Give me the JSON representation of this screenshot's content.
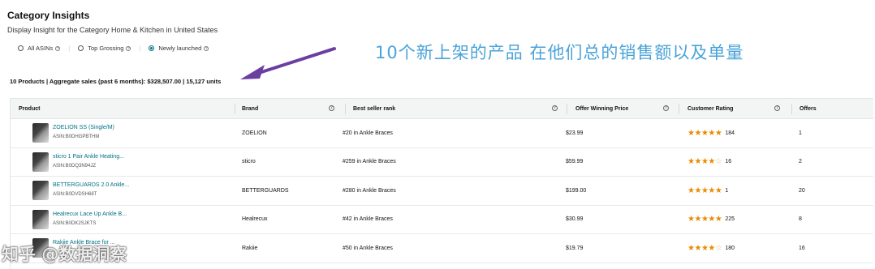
{
  "header": {
    "title": "Category Insights",
    "subtitle": "Display Insight for the Category Home & Kitchen in United States"
  },
  "filters": {
    "options": [
      {
        "label": "All ASINs",
        "checked": false
      },
      {
        "label": "Top Grossing",
        "checked": false
      },
      {
        "label": "Newly launched",
        "checked": true
      }
    ]
  },
  "annotation": {
    "text": "10个新上架的产品 在他们总的销售额以及单量"
  },
  "summary": {
    "text": "10 Products | Aggregate sales (past 6 months): $328,507.00 | 15,127 units"
  },
  "table": {
    "columns": {
      "product": "Product",
      "brand": "Brand",
      "rank": "Best seller rank",
      "price": "Offer Winning Price",
      "rating": "Customer Rating",
      "offers": "Offers"
    },
    "rows": [
      {
        "name": "ZOELION SS (Single/M)",
        "asin": "ASIN:B0DHGPBTHM",
        "brand": "ZOELION",
        "rank": "#20 in Ankle Braces",
        "price": "$23.99",
        "stars": 4.5,
        "reviews": "184",
        "offers": "1"
      },
      {
        "name": "sticro 1 Pair Ankle Heating...",
        "asin": "ASIN:B0DQ3N94JZ",
        "brand": "sticro",
        "rank": "#259 in Ankle Braces",
        "price": "$59.99",
        "stars": 4.0,
        "reviews": "16",
        "offers": "2"
      },
      {
        "name": "BETTERGUARDS 2.0 Ankle...",
        "asin": "ASIN:B0DVDSH68T",
        "brand": "BETTERGUARDS",
        "rank": "#280 in Ankle Braces",
        "price": "$199.00",
        "stars": 5.0,
        "reviews": "1",
        "offers": "20"
      },
      {
        "name": "Healrecux Lace Up Ankle B...",
        "asin": "ASIN:B0DK2SJKTS",
        "brand": "Healrecux",
        "rank": "#42 in Ankle Braces",
        "price": "$30.99",
        "stars": 4.5,
        "reviews": "225",
        "offers": "8"
      },
      {
        "name": "Rakiie Ankle Brace for ...",
        "asin": "",
        "brand": "Rakiie",
        "rank": "#50 in Ankle Braces",
        "price": "$19.79",
        "stars": 4.0,
        "reviews": "180",
        "offers": "16"
      }
    ]
  },
  "watermark": {
    "text": "知乎 @数据洞察"
  },
  "colors": {
    "link": "#007185",
    "star": "#e88b00",
    "annotation": "#4aa3d8",
    "arrow": "#6b3fa0"
  }
}
